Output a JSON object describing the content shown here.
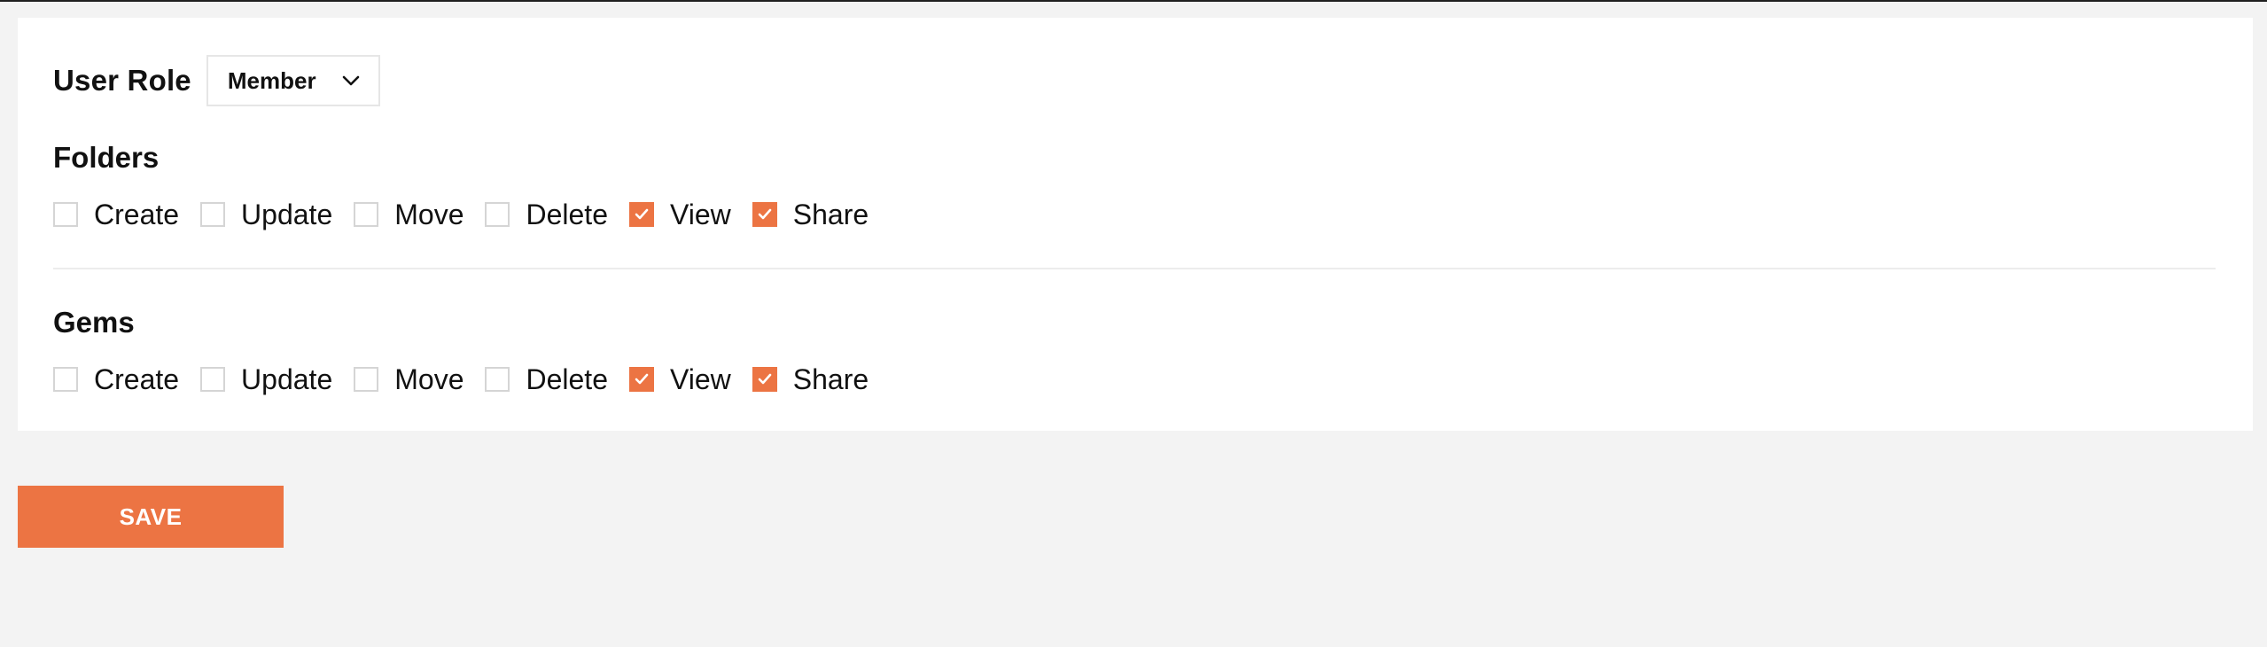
{
  "role": {
    "label": "User Role",
    "selected": "Member"
  },
  "sections": [
    {
      "title": "Folders",
      "permissions": [
        {
          "label": "Create",
          "checked": false
        },
        {
          "label": "Update",
          "checked": false
        },
        {
          "label": "Move",
          "checked": false
        },
        {
          "label": "Delete",
          "checked": false
        },
        {
          "label": "View",
          "checked": true
        },
        {
          "label": "Share",
          "checked": true
        }
      ]
    },
    {
      "title": "Gems",
      "permissions": [
        {
          "label": "Create",
          "checked": false
        },
        {
          "label": "Update",
          "checked": false
        },
        {
          "label": "Move",
          "checked": false
        },
        {
          "label": "Delete",
          "checked": false
        },
        {
          "label": "View",
          "checked": true
        },
        {
          "label": "Share",
          "checked": true
        }
      ]
    }
  ],
  "actions": {
    "save_label": "SAVE"
  },
  "colors": {
    "accent": "#ec7443",
    "page_background": "#f3f3f3",
    "card_background": "#ffffff"
  },
  "icons": {
    "dropdown": "chevron-down-icon",
    "checkbox_checked": "checkmark-icon"
  }
}
